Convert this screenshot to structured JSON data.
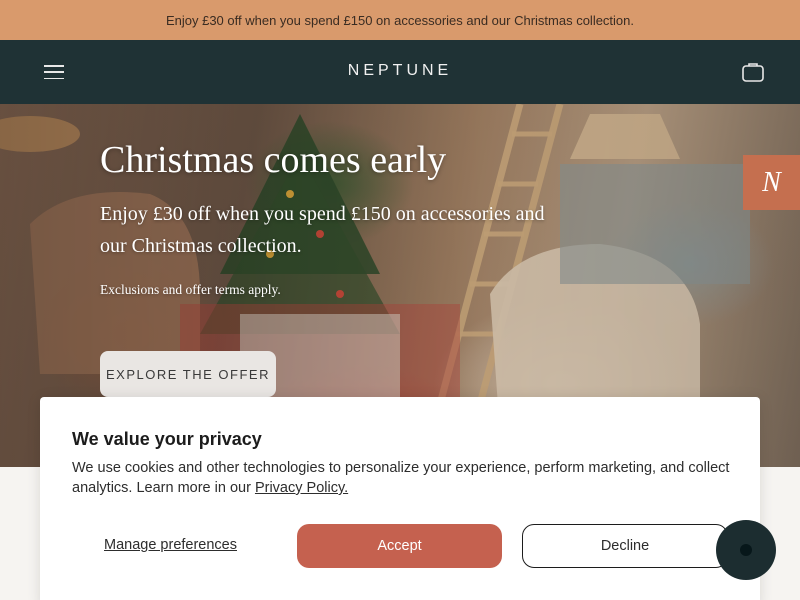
{
  "promo": {
    "text": "Enjoy £30 off when you spend £150 on accessories and our Christmas collection."
  },
  "header": {
    "logo": "NEPTUNE",
    "menu_icon": "hamburger-menu-icon",
    "bag_icon": "shopping-bag-icon"
  },
  "hero": {
    "title": "Christmas comes early",
    "subtitle": "Enjoy £30 off when you spend £150 on accessories and our Christmas collection.",
    "terms": "Exclusions and offer terms apply.",
    "cta_label": "EXPLORE THE OFFER"
  },
  "side_badge": {
    "letter": "N"
  },
  "cookie_banner": {
    "title": "We value your privacy",
    "body_text": "We use cookies and other technologies to personalize your experience, perform marketing, and collect analytics. Learn more in our ",
    "policy_link": "Privacy Policy.",
    "manage_label": "Manage preferences",
    "accept_label": "Accept",
    "decline_label": "Decline"
  },
  "chat": {
    "icon": "chat-icon"
  },
  "colors": {
    "promo_bg": "#d99a6c",
    "header_bg": "#1f3235",
    "accept_bg": "#c5614f",
    "badge_bg": "#c56f4f",
    "chat_bg": "#1c2d30"
  }
}
